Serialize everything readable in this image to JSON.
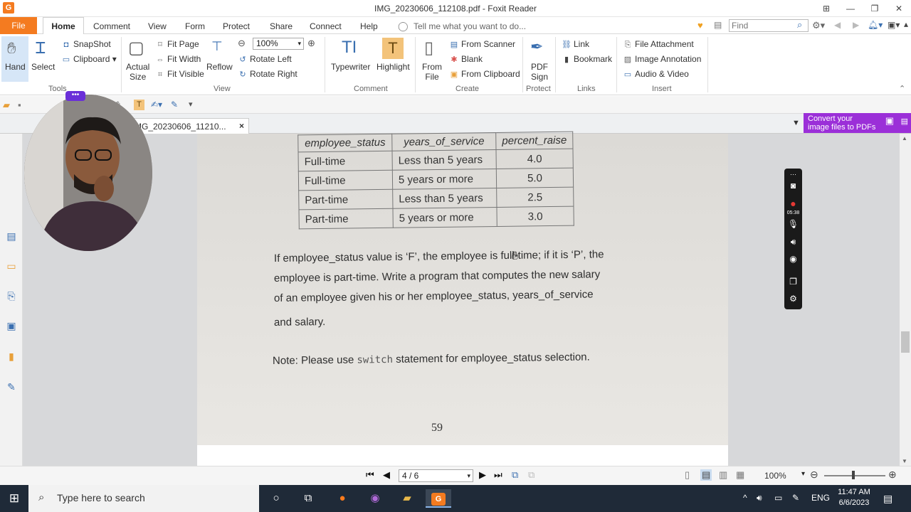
{
  "window": {
    "title": "IMG_20230606_112108.pdf - Foxit Reader",
    "app_icon": "G"
  },
  "menu": {
    "file": "File",
    "home": "Home",
    "tabs": [
      "Comment",
      "View",
      "Form",
      "Protect",
      "Share",
      "Connect",
      "Help"
    ],
    "tell_me": "Tell me what you want to do...",
    "find_placeholder": "Find"
  },
  "ribbon": {
    "tools": {
      "hand": "Hand",
      "select": "Select",
      "snapshot": "SnapShot",
      "clipboard": "Clipboard",
      "label": "Tools"
    },
    "view": {
      "actual_size_1": "Actual",
      "actual_size_2": "Size",
      "fit_page": "Fit Page",
      "fit_width": "Fit Width",
      "fit_visible": "Fit Visible",
      "reflow": "Reflow",
      "zoom": "100%",
      "rotate_left": "Rotate Left",
      "rotate_right": "Rotate Right",
      "label": "View"
    },
    "comment": {
      "typewriter": "Typewriter",
      "highlight": "Highlight",
      "label": "Comment"
    },
    "create": {
      "from_file_1": "From",
      "from_file_2": "File",
      "from_scanner": "From Scanner",
      "blank": "Blank",
      "from_clipboard": "From Clipboard",
      "label": "Create"
    },
    "protect": {
      "pdf_sign_1": "PDF",
      "pdf_sign_2": "Sign",
      "label": "Protect"
    },
    "links": {
      "link": "Link",
      "bookmark": "Bookmark",
      "label": "Links"
    },
    "insert": {
      "file_attachment": "File Attachment",
      "image_annotation": "Image Annotation",
      "audio_video": "Audio & Video",
      "label": "Insert"
    }
  },
  "doc_tab": {
    "title": "MG_20230606_11210...",
    "close": "×"
  },
  "promo": {
    "line1": "Convert your",
    "line2": "image files to PDFs"
  },
  "document": {
    "table": {
      "headers": [
        "employee_status",
        "years_of_service",
        "percent_raise"
      ],
      "rows": [
        [
          "Full-time",
          "Less than 5 years",
          "4.0"
        ],
        [
          "Full-time",
          "5 years or more",
          "5.0"
        ],
        [
          "Part-time",
          "Less than 5 years",
          "2.5"
        ],
        [
          "Part-time",
          "5 years or more",
          "3.0"
        ]
      ]
    },
    "para_lines": [
      "If employee_status value is ‘F’, the employee is full-time; if it is ‘P’, the",
      "employee is part-time. Write a program that computes the new salary",
      "of an employee given his or her employee_status, years_of_service",
      "and salary."
    ],
    "note_prefix": "Note: Please use ",
    "note_code": "switch",
    "note_suffix": " statement for employee_status selection.",
    "page_number": "59"
  },
  "recorder": {
    "time": "05:38"
  },
  "status": {
    "page": "4 / 6",
    "zoom": "100%"
  },
  "taskbar": {
    "search": "Type here to search",
    "time": "11:47 AM",
    "date": "6/6/2023",
    "lang": "ENG"
  }
}
